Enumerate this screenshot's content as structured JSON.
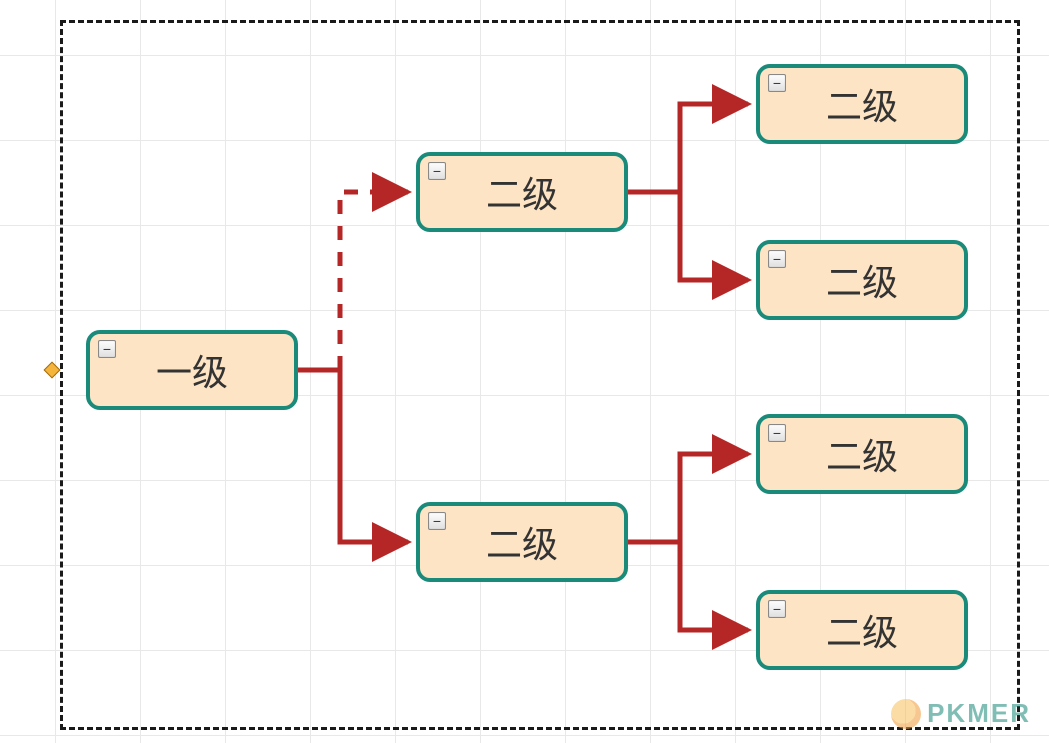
{
  "nodes": {
    "root": {
      "label": "一级"
    },
    "n1": {
      "label": "二级"
    },
    "n2": {
      "label": "二级"
    },
    "n1a": {
      "label": "二级"
    },
    "n1b": {
      "label": "二级"
    },
    "n2a": {
      "label": "二级"
    },
    "n2b": {
      "label": "二级"
    }
  },
  "collapse_glyph": "−",
  "watermark": "PKMER",
  "colors": {
    "node_fill": "#fde4c4",
    "node_border": "#1a8a7a",
    "connector": "#b52626",
    "selection": "#1a1a1a"
  }
}
